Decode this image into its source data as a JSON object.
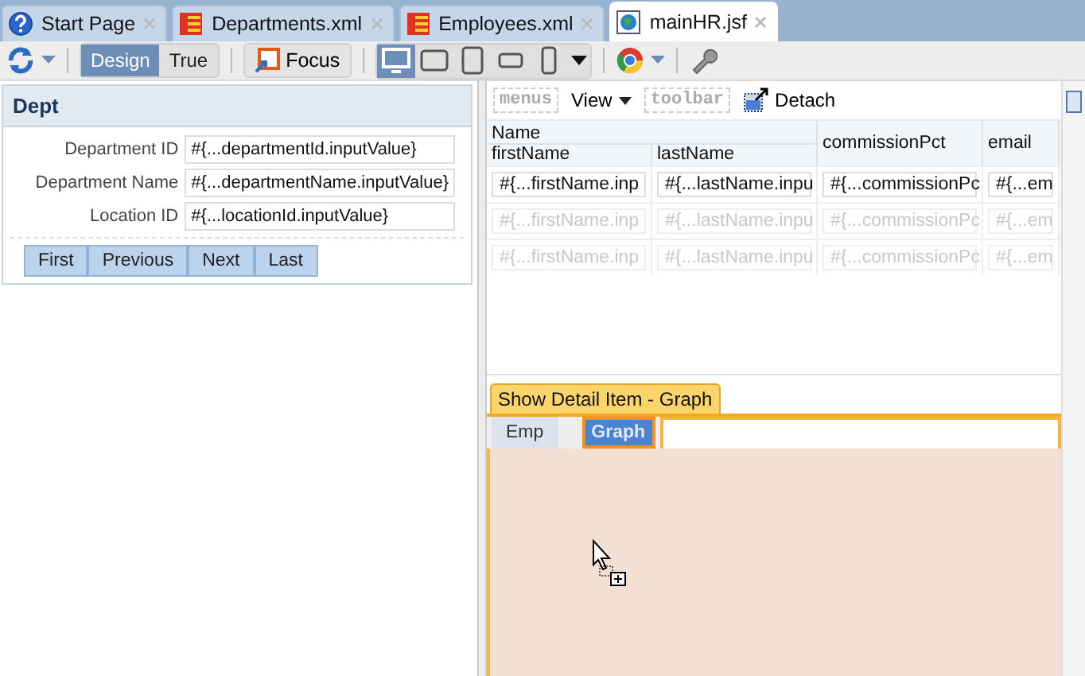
{
  "tabs": [
    {
      "label": "Start Page",
      "kind": "help",
      "selected": false
    },
    {
      "label": "Departments.xml",
      "kind": "xml",
      "selected": false
    },
    {
      "label": "Employees.xml",
      "kind": "xml",
      "selected": false
    },
    {
      "label": "mainHR.jsf",
      "kind": "page",
      "selected": true
    }
  ],
  "toolbar": {
    "modes": [
      {
        "label": "Design",
        "selected": true
      },
      {
        "label": "True",
        "selected": false
      }
    ],
    "focus": "Focus",
    "devices": [
      {
        "kind": "desktop",
        "selected": true
      },
      {
        "kind": "tablet-wide",
        "selected": false
      },
      {
        "kind": "tablet",
        "selected": false
      },
      {
        "kind": "phone-wide",
        "selected": false
      },
      {
        "kind": "phone",
        "selected": false
      }
    ]
  },
  "form": {
    "title": "Dept",
    "fields": [
      {
        "label": "Department ID",
        "value": "#{...departmentId.inputValue}"
      },
      {
        "label": "Department Name",
        "value": "#{...departmentName.inputValue}"
      },
      {
        "label": "Location ID",
        "value": "#{...locationId.inputValue}"
      }
    ],
    "buttons": [
      "First",
      "Previous",
      "Next",
      "Last"
    ]
  },
  "table_toolbar": {
    "menus": "menus",
    "view": "View",
    "toolbar": "toolbar",
    "detach": "Detach"
  },
  "table": {
    "group": "Name",
    "columns": [
      "firstName",
      "lastName",
      "commissionPct",
      "email"
    ],
    "rows": [
      {
        "ghost": false,
        "cells": [
          "#{...firstName.inp",
          "#{...lastName.inpu",
          "#{...commissionPc",
          "#{...em"
        ]
      },
      {
        "ghost": true,
        "cells": [
          "#{...firstName.inp",
          "#{...lastName.inpu",
          "#{...commissionPc",
          "#{...em"
        ]
      },
      {
        "ghost": true,
        "cells": [
          "#{...firstName.inp",
          "#{...lastName.inpu",
          "#{...commissionPc",
          "#{...em"
        ]
      }
    ]
  },
  "detail": {
    "title": "Show Detail Item - Graph",
    "tabs": [
      {
        "label": "Emp",
        "selected": false
      },
      {
        "label": "Graph",
        "selected": true
      }
    ]
  }
}
